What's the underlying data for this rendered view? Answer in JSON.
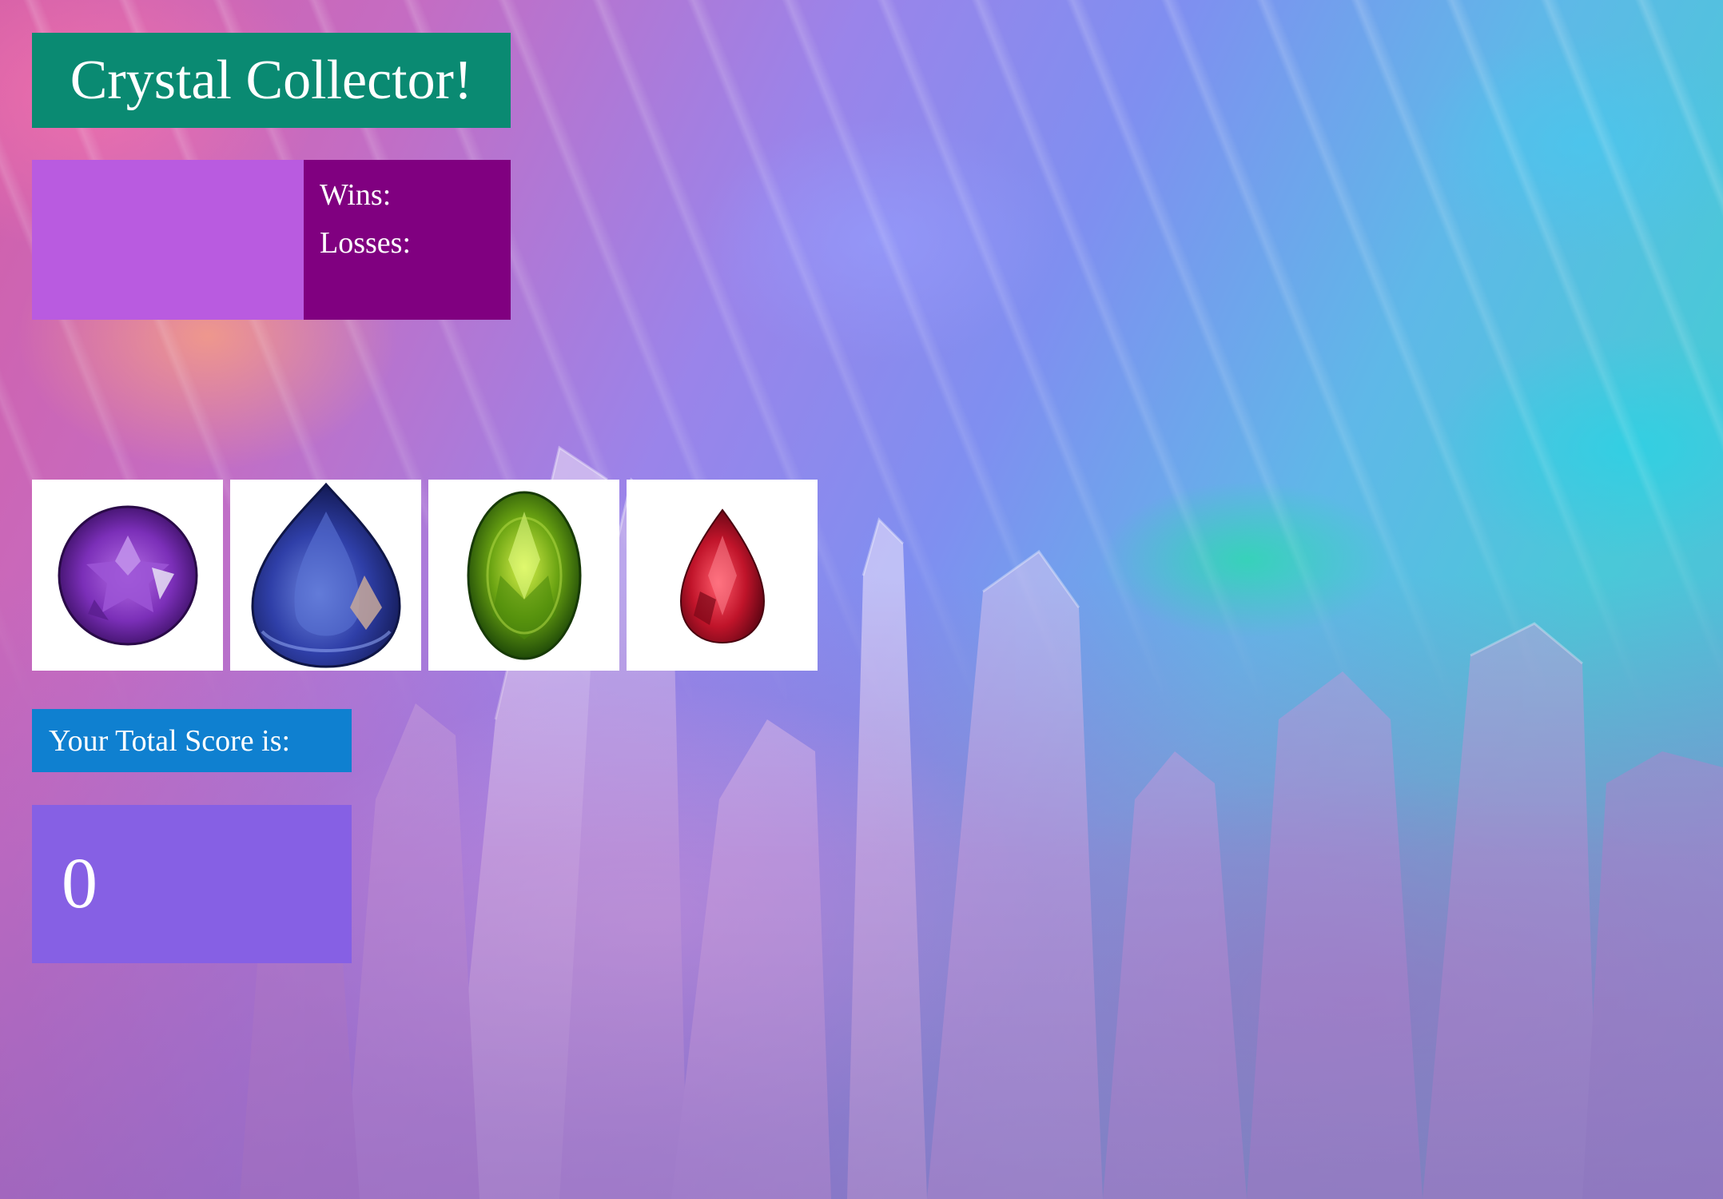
{
  "header": {
    "title": "Crystal Collector!"
  },
  "stats": {
    "target_number": "",
    "wins_label": "Wins:",
    "wins_value": "",
    "losses_label": "Losses:",
    "losses_value": ""
  },
  "crystals": [
    {
      "name": "amethyst",
      "color": "#7b2fb8",
      "icon": "round-purple-gem-icon"
    },
    {
      "name": "sapphire",
      "color": "#2f3fa8",
      "icon": "pear-blue-gem-icon"
    },
    {
      "name": "peridot",
      "color": "#6aa312",
      "icon": "oval-green-gem-icon"
    },
    {
      "name": "ruby",
      "color": "#c0142a",
      "icon": "pear-red-gem-icon"
    }
  ],
  "score": {
    "label": "Your Total Score is:",
    "value": "0"
  },
  "colors": {
    "title_bg": "#0a8a72",
    "target_bg": "#b95be0",
    "record_bg": "#800080",
    "score_label_bg": "#0f80d0",
    "score_bg": "#8660e4"
  }
}
